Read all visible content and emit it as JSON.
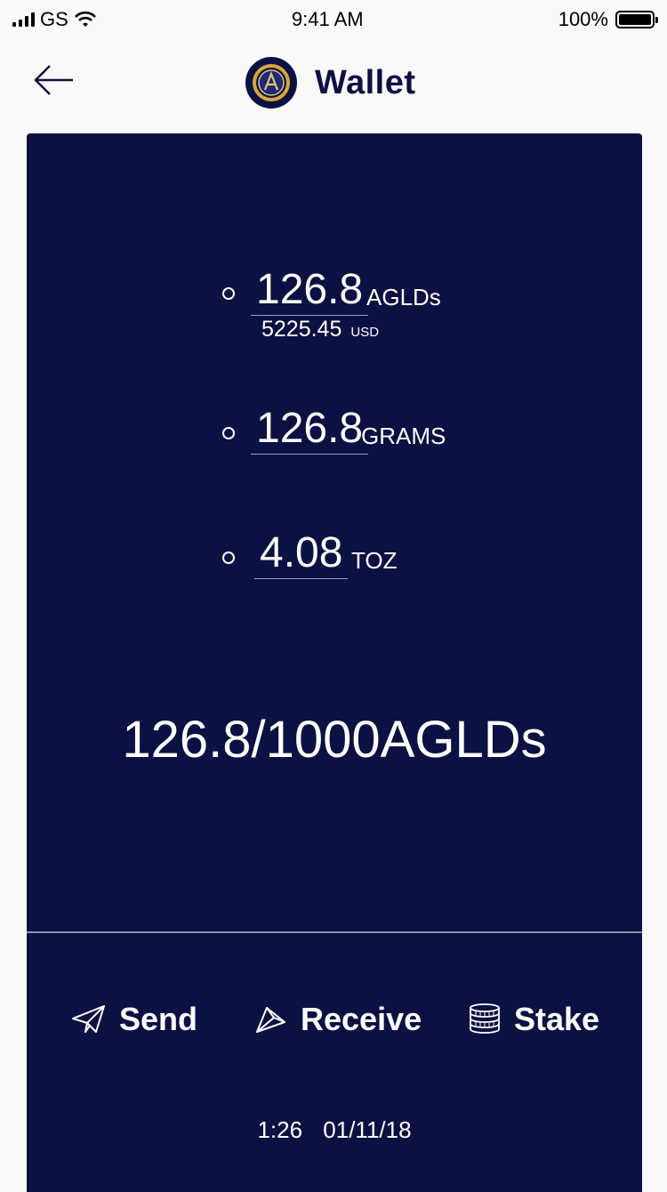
{
  "status_bar": {
    "carrier": "GS",
    "time": "9:41 AM",
    "battery": "100%"
  },
  "header": {
    "title": "Wallet",
    "back_icon": "arrow-left-icon",
    "logo_icon": "aurum-coin-logo"
  },
  "balances": {
    "aglds": {
      "amount": "126.8",
      "unit": "AGLDs",
      "usd_value": "5225.45",
      "usd_unit": "USD"
    },
    "grams": {
      "amount": "126.8",
      "unit": "GRAMS"
    },
    "toz": {
      "amount": "4.08",
      "unit": "TOZ"
    }
  },
  "progress": {
    "text": "126.8/1000AGLDs"
  },
  "actions": {
    "send": {
      "label": "Send",
      "icon": "paper-plane-icon"
    },
    "receive": {
      "label": "Receive",
      "icon": "paper-plane-outline-icon"
    },
    "stake": {
      "label": "Stake",
      "icon": "coin-stack-icon"
    }
  },
  "timestamp": {
    "time": "1:26",
    "date": "01/11/18"
  },
  "colors": {
    "card_bg": "#0b1142",
    "text_dark": "#0b1243",
    "page_bg": "#f9f9f9",
    "accent_gold": "#d4a73a"
  }
}
